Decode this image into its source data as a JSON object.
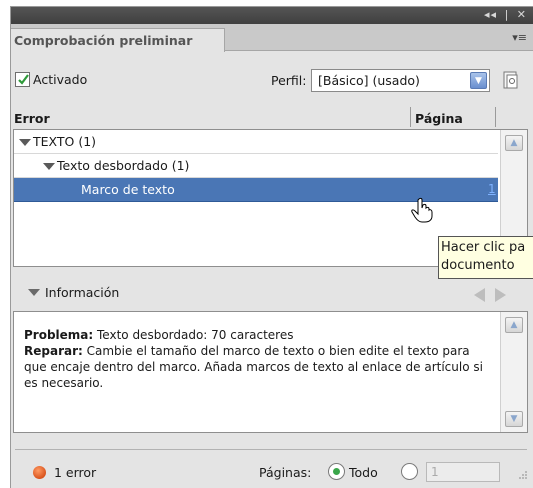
{
  "window": {
    "controls": [
      "◂◂",
      "|",
      "✕"
    ],
    "tab_title": "Comprobación preliminar",
    "panel_menu_icon": "panel-menu-icon"
  },
  "options": {
    "enabled_checked": true,
    "enabled_label": "Activado",
    "profile_label": "Perfil:",
    "profile_value": "[Básico] (usado)"
  },
  "columns": {
    "error": "Error",
    "page": "Página"
  },
  "tree": {
    "rows": [
      {
        "label": "TEXTO (1)",
        "expanded": true,
        "level": 0,
        "page": ""
      },
      {
        "label": "Texto desbordado (1)",
        "expanded": true,
        "level": 1,
        "page": ""
      },
      {
        "label": "Marco de texto",
        "selected": true,
        "level": 2,
        "page": "1"
      }
    ]
  },
  "tooltip": {
    "line1": "Hacer clic pa",
    "line2": "documento"
  },
  "info": {
    "heading": "Información",
    "problem_label": "Problema:",
    "problem_text": " Texto desbordado: 70 caracteres",
    "fix_label": "Reparar:",
    "fix_text": " Cambie el tamaño del marco de texto o bien edite el texto para que encaje dentro del marco. Añada marcos de texto al enlace de artículo si es necesario."
  },
  "footer": {
    "error_count_text": "1 error",
    "pages_label": "Páginas:",
    "all_label": "Todo",
    "all_selected": true,
    "range_value": "1"
  },
  "colors": {
    "selection": "#4a76b5",
    "error_dot": "#d9541d",
    "radio_on": "#3aa64a"
  }
}
